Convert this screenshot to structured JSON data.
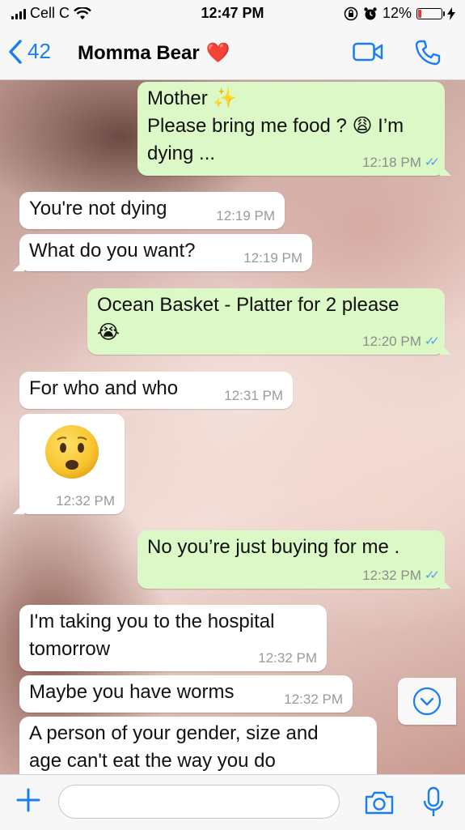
{
  "status_bar": {
    "carrier": "Cell C",
    "time": "12:47 PM",
    "battery": "12%",
    "battery_level": 0.12
  },
  "nav": {
    "back_count": "42",
    "contact_name": "Momma Bear",
    "contact_emoji": "❤️",
    "icons": [
      "chevron-left-icon",
      "video-call-icon",
      "phone-icon"
    ]
  },
  "messages": [
    {
      "dir": "out",
      "lines": [
        "Mother ✨",
        "Please bring me food ? 😩 I’m",
        "dying ..."
      ],
      "time": "12:18 PM",
      "ticks": "✓✓"
    },
    {
      "dir": "in",
      "lines": [
        "You're not dying"
      ],
      "time": "12:19 PM"
    },
    {
      "dir": "in",
      "lines": [
        "What do you want?"
      ],
      "time": "12:19 PM"
    },
    {
      "dir": "out",
      "lines": [
        "Ocean Basket - Platter for 2 please",
        "😭"
      ],
      "time": "12:20 PM",
      "ticks": "✓✓"
    },
    {
      "dir": "in",
      "lines": [
        "For who and who"
      ],
      "time": "12:31 PM"
    },
    {
      "dir": "in",
      "lines": [
        "😦"
      ],
      "time": "12:32 PM"
    },
    {
      "dir": "out",
      "lines": [
        "No you’re just buying for me ."
      ],
      "time": "12:32 PM",
      "ticks": "✓✓"
    },
    {
      "dir": "in",
      "lines": [
        "I'm taking you to the hospital",
        "tomorrow"
      ],
      "time": "12:32 PM"
    },
    {
      "dir": "in",
      "lines": [
        "Maybe you have worms"
      ],
      "time": "12:32 PM"
    },
    {
      "dir": "in",
      "lines": [
        "A person of your gender, size and",
        "age can't eat the way you do"
      ],
      "time": ""
    }
  ],
  "input": {
    "placeholder": ""
  },
  "colors": {
    "accent": "#1a7ef0",
    "outgoing_bubble": "#dcf8c6",
    "incoming_bubble": "#ffffff",
    "read_ticks": "#4fa3e6"
  }
}
